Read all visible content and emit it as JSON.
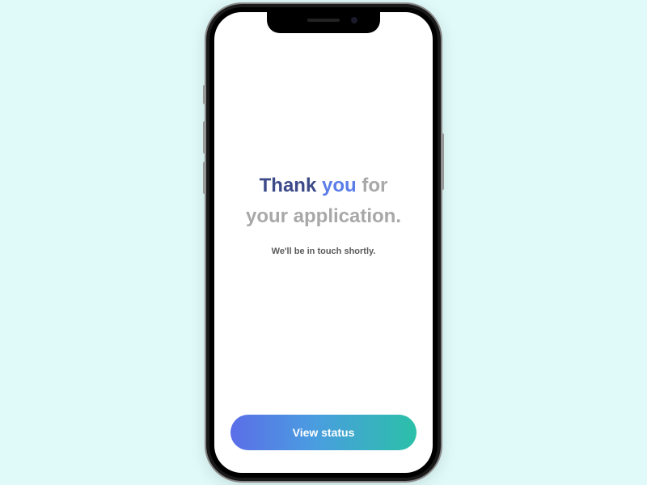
{
  "headline": {
    "thank": "Thank",
    "you": "you",
    "rest_line1": " for",
    "rest_line2": "your application."
  },
  "subtext": "We'll be in touch shortly.",
  "cta": {
    "label": "View status"
  }
}
